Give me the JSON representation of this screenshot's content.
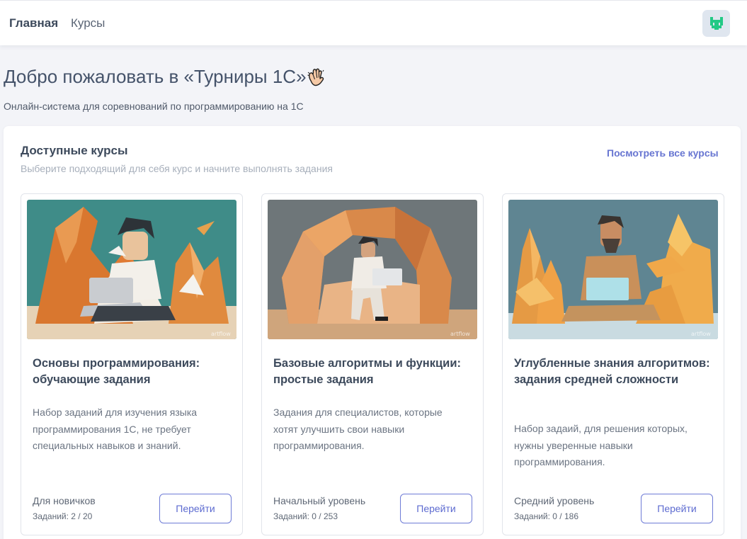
{
  "nav": {
    "home_label": "Главная",
    "courses_label": "Курсы"
  },
  "header": {
    "title": "Добро пожаловать в «Турниры 1С»",
    "title_icon": "waving-hand-icon",
    "subtitle": "Онлайн-система для соревнований по программированию на 1С"
  },
  "section": {
    "title": "Доступные курсы",
    "description": "Выберите подходящий для себя курс и начните выполнять задания",
    "view_all_label": "Посмотреть все курсы"
  },
  "courses": [
    {
      "title": "Основы программирования: обучающие задания",
      "description": "Набор заданий для изучения языка программирования 1С, не требует специальных навыков и знаний.",
      "level": "Для новичков",
      "tasks": "Заданий: 2 / 20",
      "button_label": "Перейти",
      "image_watermark": "artflow"
    },
    {
      "title": "Базовые алгоритмы и функции: простые задания",
      "description": "Задания для специалистов, которые хотят улучшить свои навыки программирования.",
      "level": "Начальный уровень",
      "tasks": "Заданий: 0 / 253",
      "button_label": "Перейти",
      "image_watermark": "artflow"
    },
    {
      "title": "Углубленные знания алгоритмов: задания средней сложности",
      "description": "Набор задаий, для решения которых, нужны уверенные навыки программирования.",
      "level": "Средний уровень",
      "tasks": "Заданий: 0 / 186",
      "button_label": "Перейти",
      "image_watermark": "artflow"
    }
  ],
  "colors": {
    "accent": "#6775d1",
    "text": "#3d4a5c",
    "muted": "#a7afbb",
    "background": "#f3f4f8",
    "avatar_green": "#23c985"
  }
}
